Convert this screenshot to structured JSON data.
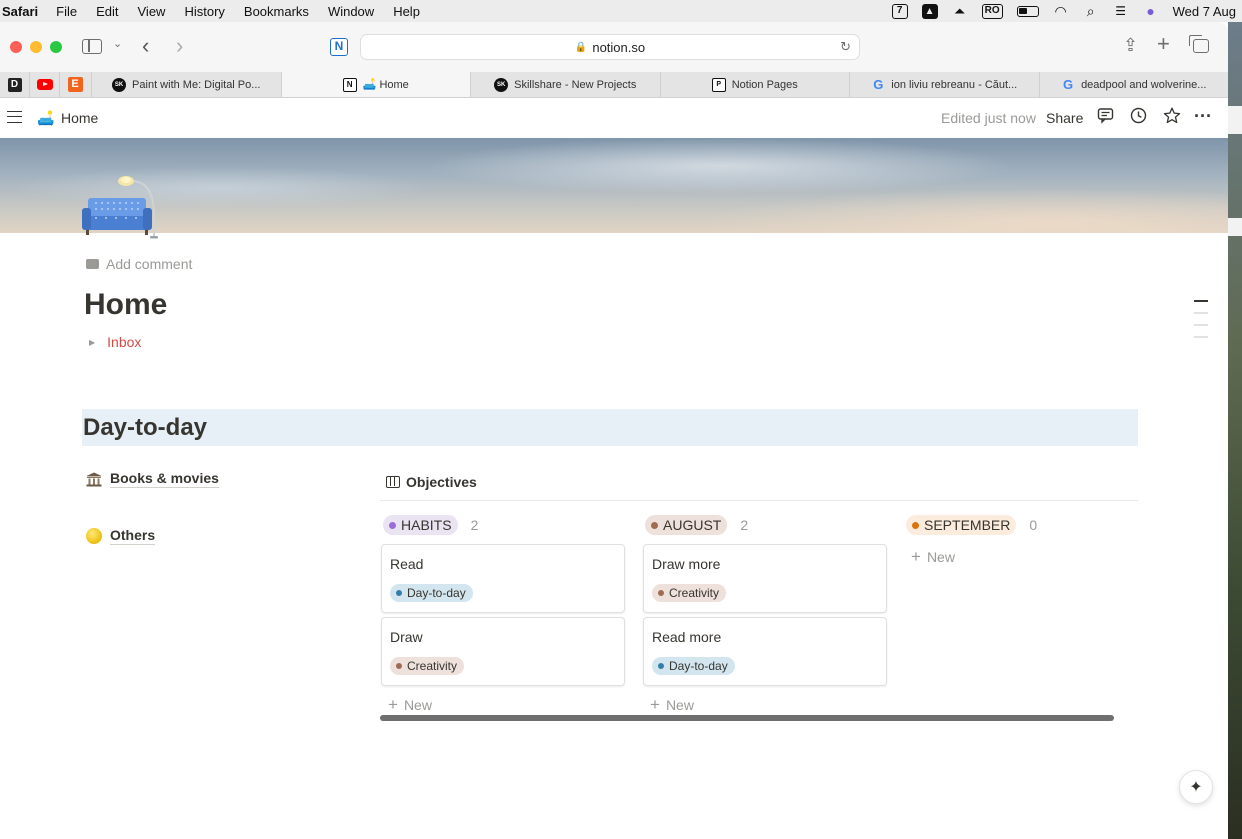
{
  "menubar": {
    "app": "Safari",
    "items": [
      "File",
      "Edit",
      "View",
      "History",
      "Bookmarks",
      "Window",
      "Help"
    ],
    "status": {
      "calendar_badge": "7",
      "input_source": "RO",
      "datetime": "Wed 7 Aug"
    }
  },
  "browser": {
    "url": "notion.so",
    "pinned_tabs": [
      "D",
      "youtube",
      "E"
    ],
    "tabs": [
      {
        "favicon": "SK",
        "label": "Paint with Me: Digital Po..."
      },
      {
        "favicon": "N",
        "label": "🛋️ Home",
        "active": true
      },
      {
        "favicon": "SK",
        "label": "Skillshare - New Projects"
      },
      {
        "favicon": "P",
        "label": "Notion Pages"
      },
      {
        "favicon": "G",
        "label": "ion liviu rebreanu - Căut..."
      },
      {
        "favicon": "G",
        "label": "deadpool and wolverine..."
      }
    ]
  },
  "notion_topbar": {
    "page_emoji": "🛋️",
    "breadcrumb": "Home",
    "edited": "Edited just now",
    "share": "Share"
  },
  "page": {
    "icon": "couch-and-lamp",
    "add_comment": "Add comment",
    "title": "Home",
    "toggle": "Inbox",
    "heading": "Day-to-day",
    "links": [
      {
        "emoji": "classical-building",
        "label": "Books & movies"
      },
      {
        "emoji": "yellow-circle",
        "label": "Others"
      }
    ]
  },
  "board": {
    "title": "Objectives",
    "new_label": "New",
    "columns": [
      {
        "label": "HABITS",
        "count": "2",
        "pill_bg": "#eae4f2",
        "dot": "#9a6dd7",
        "cards": [
          {
            "title": "Read",
            "tag": "Day-to-day",
            "tag_bg": "#d3e5ef",
            "tag_dot": "#337ea9"
          },
          {
            "title": "Draw",
            "tag": "Creativity",
            "tag_bg": "#eee0da",
            "tag_dot": "#9f6b53"
          }
        ]
      },
      {
        "label": "AUGUST",
        "count": "2",
        "pill_bg": "#eee0da",
        "dot": "#9f6b53",
        "cards": [
          {
            "title": "Draw more",
            "tag": "Creativity",
            "tag_bg": "#eee0da",
            "tag_dot": "#9f6b53"
          },
          {
            "title": "Read more",
            "tag": "Day-to-day",
            "tag_bg": "#d3e5ef",
            "tag_dot": "#337ea9"
          }
        ]
      },
      {
        "label": "SEPTEMBER",
        "count": "0",
        "pill_bg": "#fbecdd",
        "dot": "#d9730d",
        "cards": []
      }
    ]
  }
}
